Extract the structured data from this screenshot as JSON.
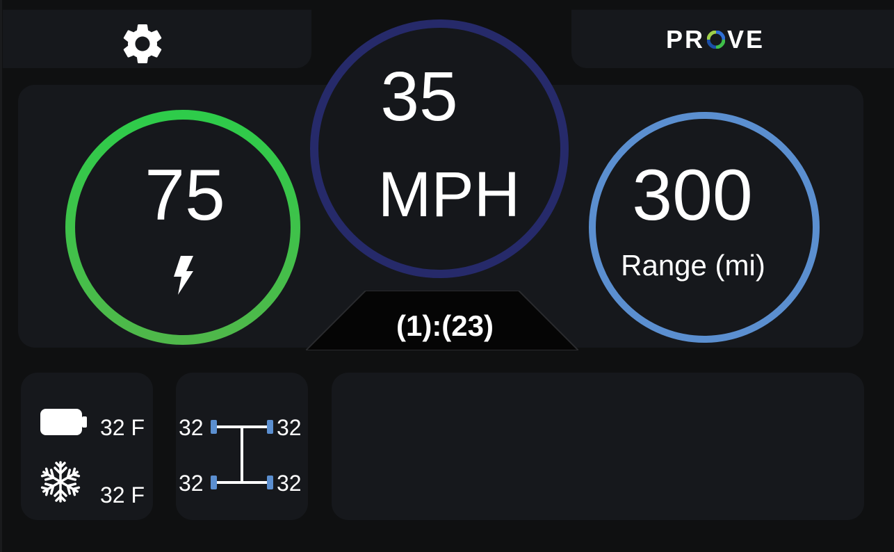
{
  "header": {
    "settings_icon": "gear-icon",
    "logo_text_left": "PR",
    "logo_text_right": "VE",
    "logo_colors": [
      "#2f6fd6",
      "#3fbf4a",
      "#1b4fa8",
      "#9fd04a"
    ]
  },
  "battery_gauge": {
    "value": "75",
    "icon": "lightning-bolt-icon",
    "fill_fraction": 0.75,
    "color_top": "#2ecc4a",
    "color_bottom": "#4fb84a"
  },
  "speed_gauge": {
    "value": "35",
    "unit": "MPH",
    "color": "#262a6a"
  },
  "range_gauge": {
    "value": "300",
    "label": "Range (mi)",
    "color": "#5b8fd0"
  },
  "gear_indicator": {
    "text": "(1):(23)"
  },
  "temperatures": {
    "battery_icon": "battery-icon",
    "battery_temp": "32 F",
    "cabin_icon": "snowflake-icon",
    "cabin_temp": "32 F"
  },
  "tires": {
    "icon": "axle-diagram-icon",
    "front_left": "32",
    "front_right": "32",
    "rear_left": "32",
    "rear_right": "32",
    "indicator_color": "#5b8fd0"
  }
}
